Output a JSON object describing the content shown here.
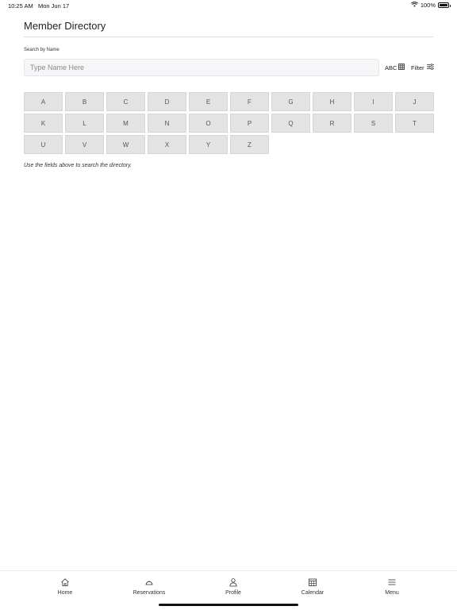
{
  "status": {
    "time": "10:25 AM",
    "date": "Mon Jun 17",
    "battery": "100%",
    "battery_level": 1.0
  },
  "page": {
    "title": "Member Directory"
  },
  "search": {
    "label": "Search by Name",
    "placeholder": "Type Name Here",
    "value": ""
  },
  "controls": {
    "abc_label": "ABC",
    "filter_label": "Filter"
  },
  "letters": [
    "A",
    "B",
    "C",
    "D",
    "E",
    "F",
    "G",
    "H",
    "I",
    "J",
    "K",
    "L",
    "M",
    "N",
    "O",
    "P",
    "Q",
    "R",
    "S",
    "T",
    "U",
    "V",
    "W",
    "X",
    "Y",
    "Z"
  ],
  "hint": "Use the fields above to search the directory.",
  "tabs": [
    {
      "label": "Home",
      "icon": "home-icon"
    },
    {
      "label": "Reservations",
      "icon": "cloche-icon"
    },
    {
      "label": "Profile",
      "icon": "person-icon"
    },
    {
      "label": "Calendar",
      "icon": "calendar-icon"
    },
    {
      "label": "Menu",
      "icon": "hamburger-icon"
    }
  ],
  "colors": {
    "letter_bg": "#e3e3e3",
    "input_bg": "#f6f6f8"
  }
}
